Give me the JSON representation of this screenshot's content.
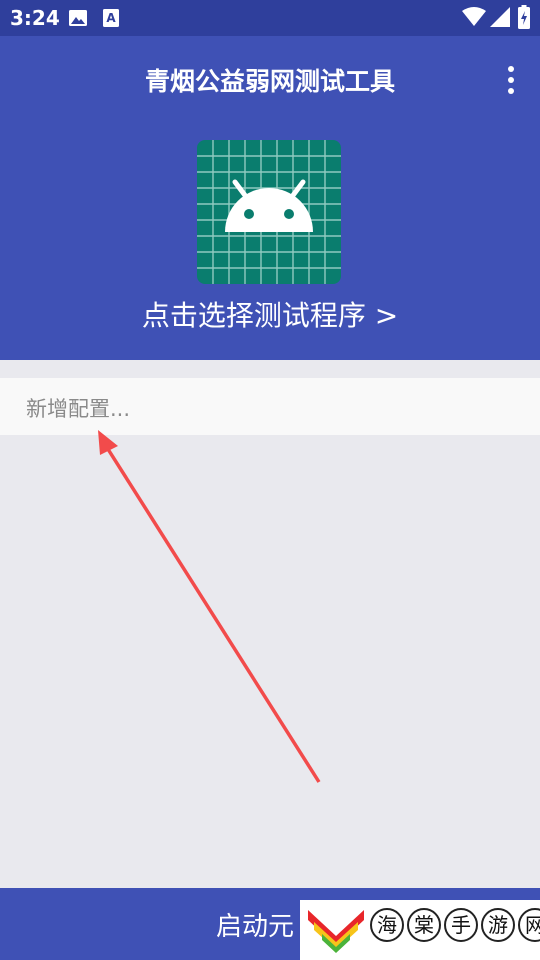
{
  "status_bar": {
    "time": "3:24",
    "left_icons": [
      "image-icon",
      "text-a-icon"
    ],
    "right_icons": [
      "wifi-icon",
      "signal-icon",
      "battery-icon"
    ]
  },
  "header": {
    "title": "青烟公益弱网测试工具",
    "menu_icon": "more-vert-icon",
    "app_icon": "android-icon",
    "select_program_label": "点击选择测试程序 >"
  },
  "config_list": {
    "new_config_label": "新增配置..."
  },
  "bottom_bar": {
    "start_label": "启动元"
  },
  "watermark": {
    "chars": [
      "海",
      "棠",
      "手",
      "游",
      "网"
    ]
  },
  "colors": {
    "primary": "#3f51b5",
    "primary_dark": "#2f3f9c",
    "icon_green": "#0a7d6e",
    "background": "#e9e9ee",
    "arrow_red": "#f24b4b"
  }
}
